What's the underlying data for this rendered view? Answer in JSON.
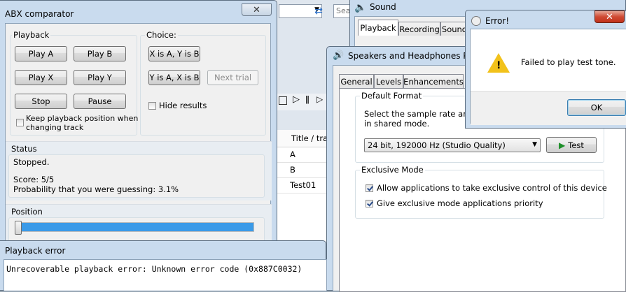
{
  "abx": {
    "title": "ABX comparator",
    "playback_label": "Playback",
    "play_a": "Play A",
    "play_b": "Play B",
    "play_x": "Play X",
    "play_y": "Play Y",
    "stop": "Stop",
    "pause": "Pause",
    "keep_position": "Keep playback position when",
    "keep_position_2": "changing track",
    "choice_label": "Choice:",
    "x_is_a": "X is A, Y is B",
    "y_is_a": "Y is A, X is B",
    "next_trial": "Next trial",
    "hide_results": "Hide results",
    "status_label": "Status",
    "status_text": "Stopped.",
    "score": "Score: 5/5",
    "probability": "Probability that you were guessing: 3.1%",
    "position_label": "Position",
    "position_fraction": 1.0
  },
  "playback_error": {
    "title": "Playback error",
    "message": "Unrecoverable playback error: Unknown error code (0x887C0032)"
  },
  "background_app": {
    "search_placeholder": "Sea",
    "columns": [
      "Title / trac"
    ],
    "tracks": [
      "A",
      "B",
      "Test01"
    ]
  },
  "sound": {
    "title": "Sound",
    "tabs": [
      "Playback",
      "Recording",
      "Sound"
    ]
  },
  "speakers": {
    "title": "Speakers and Headphones Prop",
    "tabs": [
      "General",
      "Levels",
      "Enhancements"
    ],
    "default_format_label": "Default Format",
    "desc_1": "Select the sample rate and bit",
    "desc_2": "in shared mode.",
    "format_value": "24 bit, 192000 Hz (Studio Quality)",
    "test_button": "Test",
    "exclusive_label": "Exclusive Mode",
    "allow_exclusive": "Allow applications to take exclusive control of this device",
    "give_priority": "Give exclusive mode applications priority"
  },
  "error_dialog": {
    "title": "Error!",
    "message": "Failed to play test tone.",
    "ok": "OK"
  },
  "colors": {
    "progress": "#3a9ae8",
    "frame": "#c9dbee"
  }
}
